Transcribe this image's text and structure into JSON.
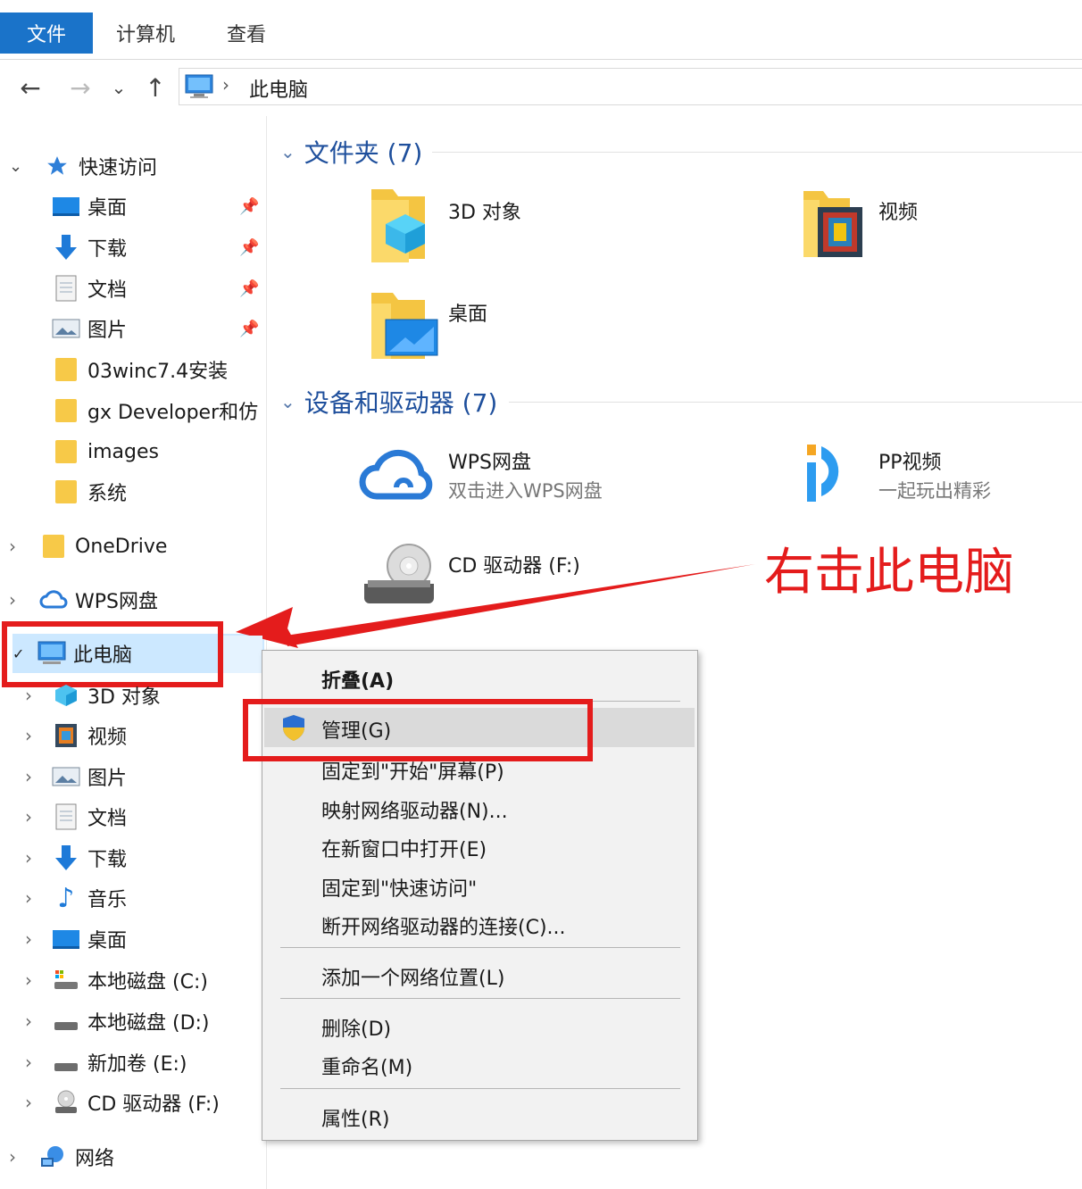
{
  "ribbon": {
    "tabs": [
      "文件",
      "计算机",
      "查看"
    ]
  },
  "address": {
    "path": "此电脑",
    "sep": "›"
  },
  "nav": {
    "back": "←",
    "forward": "→",
    "recent": "⌄",
    "up": "↑"
  },
  "sidebar": {
    "quick_access": "快速访问",
    "qa_items": [
      "桌面",
      "下载",
      "文档",
      "图片",
      "03winc7.4安装",
      "gx Developer和仿",
      "images",
      "系统"
    ],
    "onedrive": "OneDrive",
    "wps": "WPS网盘",
    "this_pc": "此电脑",
    "pc_items": [
      "3D 对象",
      "视频",
      "图片",
      "文档",
      "下载",
      "音乐",
      "桌面",
      "本地磁盘 (C:)",
      "本地磁盘 (D:)",
      "新加卷 (E:)",
      "CD 驱动器 (F:)"
    ],
    "network": "网络"
  },
  "content": {
    "folders_header": "文件夹 (7)",
    "folders": [
      "3D 对象",
      "视频",
      "桌面"
    ],
    "devices_header": "设备和驱动器 (7)",
    "devices": [
      {
        "name": "WPS网盘",
        "sub": "双击进入WPS网盘"
      },
      {
        "name": "PP视频",
        "sub": "一起玩出精彩"
      },
      {
        "name": "CD 驱动器 (F:)"
      }
    ]
  },
  "context_menu": {
    "items": [
      "折叠(A)",
      "管理(G)",
      "固定到\"开始\"屏幕(P)",
      "映射网络驱动器(N)...",
      "在新窗口中打开(E)",
      "固定到\"快速访问\"",
      "断开网络驱动器的连接(C)...",
      "添加一个网络位置(L)",
      "删除(D)",
      "重命名(M)",
      "属性(R)"
    ]
  },
  "annotation": {
    "text": "右击此电脑"
  },
  "colors": {
    "accent": "#1a73c9",
    "highlight": "#cce8ff",
    "annot": "#e41c1c",
    "folder": "#f7c948"
  }
}
